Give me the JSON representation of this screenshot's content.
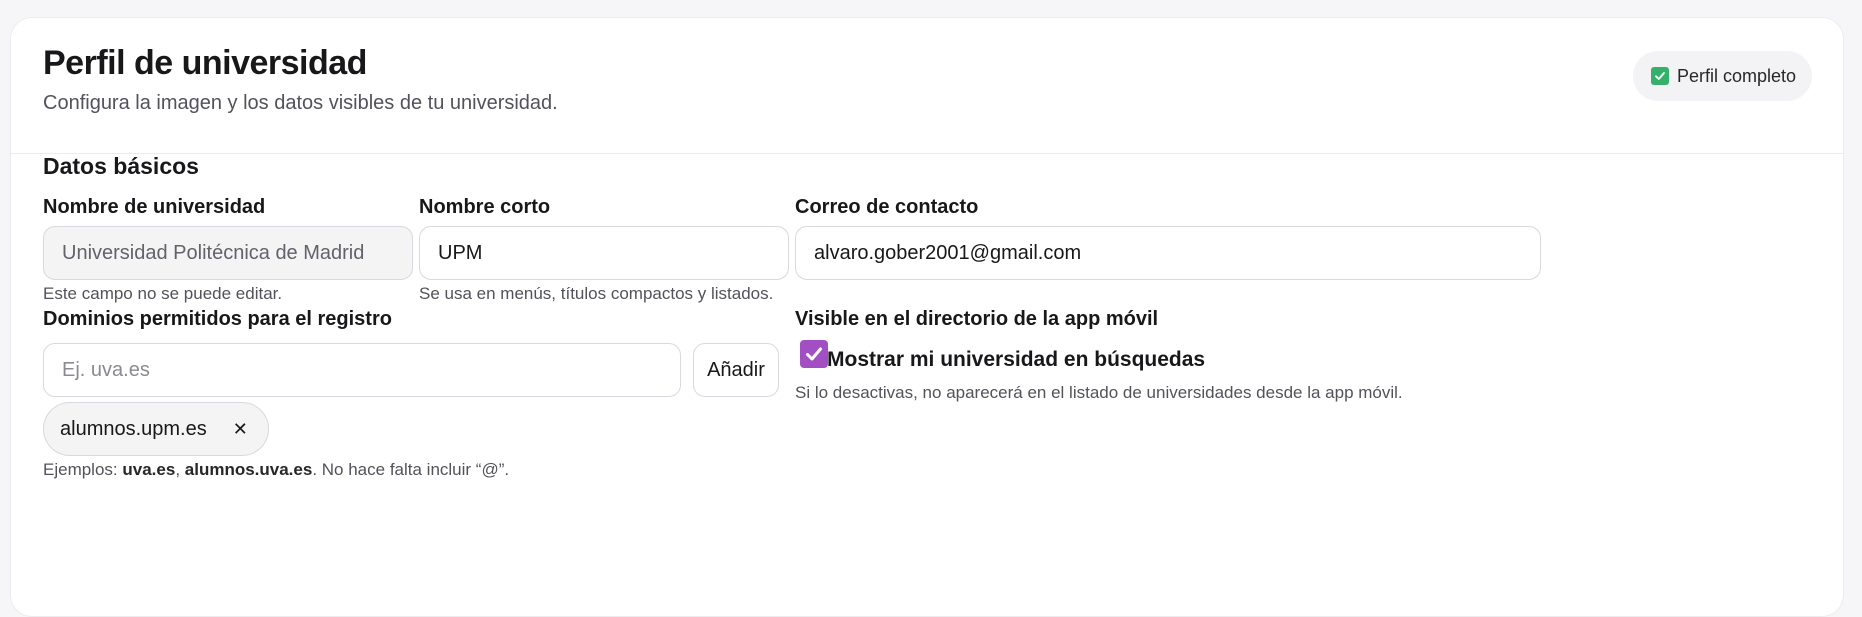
{
  "header": {
    "title": "Perfil de universidad",
    "subtitle": "Configura la imagen y los datos visibles de tu universidad.",
    "badge": {
      "label": "Perfil completo",
      "icon": "check-square-icon",
      "color": "#34b06a"
    }
  },
  "basic": {
    "section_title": "Datos básicos",
    "university_name": {
      "label": "Nombre de universidad",
      "value": "Universidad Politécnica de Madrid",
      "hint": "Este campo no se puede editar."
    },
    "short_name": {
      "label": "Nombre corto",
      "value": "UPM",
      "hint": "Se usa en menús, títulos compactos y listados."
    },
    "contact_email": {
      "label": "Correo de contacto",
      "value": "alvaro.gober2001@gmail.com"
    },
    "domains": {
      "label": "Dominios permitidos para el registro",
      "placeholder": "Ej. uva.es",
      "add_label": "Añadir",
      "chips": [
        "alumnos.upm.es"
      ],
      "remove_icon": "close-icon",
      "hint_prefix": "Ejemplos: ",
      "hint_example_1": "uva.es",
      "hint_separator": ", ",
      "hint_example_2": "alumnos.uva.es",
      "hint_suffix": ". No hace falta incluir “@”."
    },
    "visibility": {
      "label": "Visible en el directorio de la app móvil",
      "checkbox_label": "Mostrar mi universidad en búsquedas",
      "checked": true,
      "accent": "#a34fc4",
      "hint": "Si lo desactivas, no aparecerá en el listado de universidades desde la app móvil."
    }
  }
}
